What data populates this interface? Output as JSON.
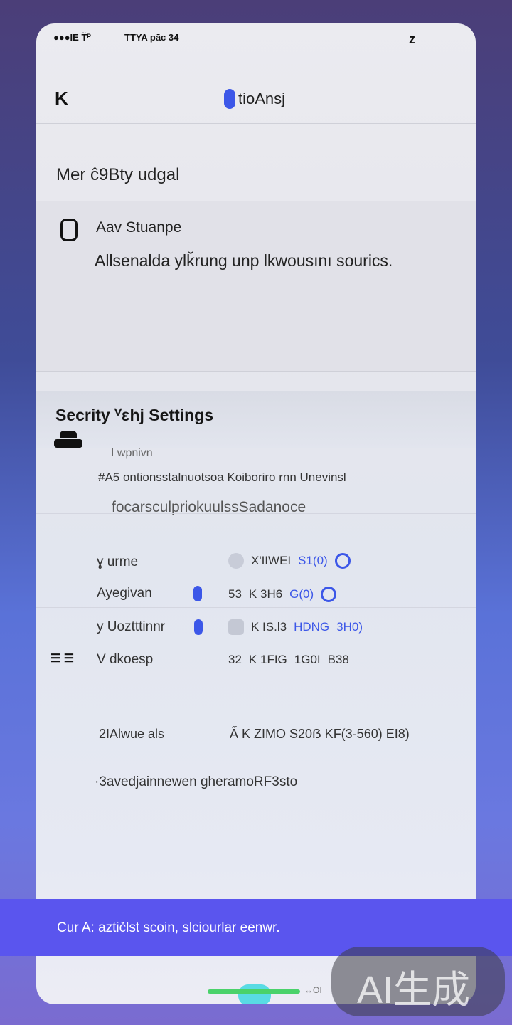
{
  "status_bar": {
    "left": "●●●IE T̈ᴾ",
    "middle": "TTYA pāc 34",
    "right": "z"
  },
  "nav": {
    "back_label": "K",
    "title": "tioAnsj"
  },
  "section_header": "Mer ĉ9Βty udgal",
  "card": {
    "title": "Aav Stuanpe",
    "description": "Allsenalda ylǩrung unp lkwousını sourics."
  },
  "security": {
    "title": "Secrity ⱽɛhj Settings",
    "small_label": "I wpnivn",
    "line1": "#A5 ontionsstalnuotsoa Koiboriro rnn Unevinsl",
    "line2": "focarsculpriokuulssSadanoce"
  },
  "permissions": [
    {
      "label": "ɣ urme",
      "values": [
        "X'IIWEI",
        "S1(0)"
      ]
    },
    {
      "label": "Ayegivan",
      "values": [
        "53",
        "K 3H6",
        "G(0)"
      ]
    },
    {
      "label": "y Uoztttinnr",
      "values": [
        "K IS.l3",
        "HDNG",
        "3H0)"
      ]
    },
    {
      "label": "V dkoesp",
      "values": [
        "32",
        "K 1FIG",
        "1G0I",
        "B38"
      ]
    }
  ],
  "summary": {
    "label": "2IAlwue als",
    "values": "A̋ K ZIMO S20ẞ KF(3-560) EI8)"
  },
  "footnote": "·3avedjainnewen gheramoRF3sto",
  "banner": "Cur A: aztičlst scoin, slciourlar eenwr.",
  "home_indicator_suffix": "↔OI",
  "watermark": "AI生成"
}
